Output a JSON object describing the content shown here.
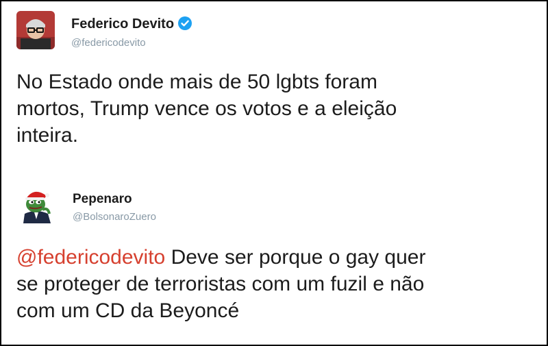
{
  "tweets": [
    {
      "author": {
        "name": "Federico Devito",
        "handle": "@federicodevito",
        "verified": true,
        "avatar_icon": "avatar-photo-icon"
      },
      "text": "No Estado onde mais de 50 lgbts foram\nmortos, Trump vence os votos e a eleição\ninteira."
    },
    {
      "author": {
        "name": "Pepenaro",
        "handle": "@BolsonaroZuero",
        "verified": false,
        "avatar_icon": "pepe-frog-santa-hat-icon"
      },
      "mention": "@federicodevito",
      "text": " Deve ser porque o gay quer\nse proteger de terroristas com um fuzil e não\ncom um CD da Beyoncé"
    }
  ],
  "colors": {
    "mention": "#d6402f",
    "verified_badge": "#1da1f2",
    "handle": "#8899a6"
  }
}
